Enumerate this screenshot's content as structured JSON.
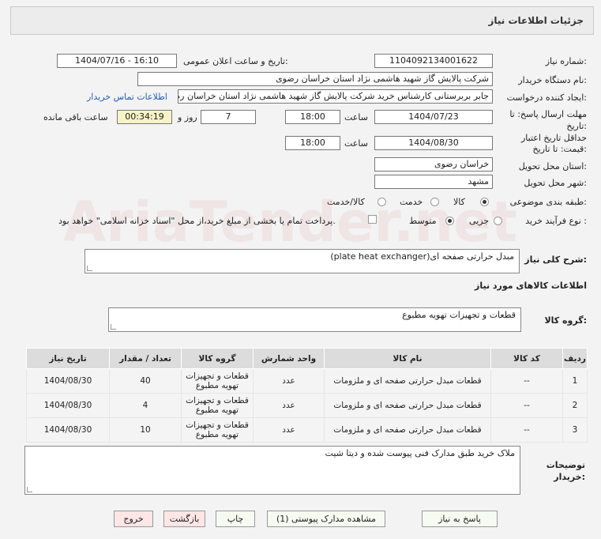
{
  "header": {
    "title": "جزئیات اطلاعات نیاز"
  },
  "fields": {
    "need_number_label": "شماره نیاز:",
    "need_number": "1104092134001622",
    "announce_label": "تاریخ و ساعت اعلان عمومی:",
    "announce_value": "1404/07/16 - 16:10",
    "buyer_org_label": "نام دستگاه خریدار:",
    "buyer_org": "شرکت پالایش گاز شهید هاشمی نژاد   استان خراسان رضوی",
    "creator_label": "ایجاد کننده درخواست:",
    "creator": "جابر بربرستانی کارشناس خرید شرکت پالایش گاز شهید هاشمی نژاد   استان خراسان رضوی",
    "contact_link": "اطلاعات تماس خریدار",
    "deadline_label_1": "مهلت ارسال پاسخ: تا",
    "deadline_label_2": "تاریخ:",
    "deadline_date": "1404/07/23",
    "time_label": "ساعت",
    "deadline_time": "18:00",
    "days_value": "7",
    "days_label": "روز و",
    "remaining_value": "00:34:19",
    "remaining_label": "ساعت باقی مانده",
    "validity_label_1": "حداقل تاریخ اعتبار",
    "validity_label_2": "قیمت: تا تاریخ:",
    "validity_date": "1404/08/30",
    "validity_time": "18:00",
    "province_label": "استان محل تحویل:",
    "province": "خراسان رضوی",
    "city_label": "شهر محل تحویل:",
    "city": "مشهد",
    "category_label": "طبقه بندی موضوعی:",
    "cat_goods": "کالا",
    "cat_service": "خدمت",
    "cat_both": "کالا/خدمت",
    "process_label": "نوع فرآیند خرید :",
    "proc_small": "جزیی",
    "proc_medium": "متوسط",
    "payment_note": "پرداخت تمام یا بخشی از مبلغ خرید،از محل \"اسناد خزانه اسلامی\" خواهد بود."
  },
  "description": {
    "label": "شرح کلی نیاز:",
    "value": "مبدل حرارتی صفحه ای(plate heat exchanger)"
  },
  "goods_info": {
    "title": "اطلاعات کالاهای مورد نیاز",
    "group_label": "گروه کالا:",
    "group_value": "قطعات و تجهیزات تهویه مطبوع"
  },
  "table": {
    "headers": [
      "ردیف",
      "کد کالا",
      "نام کالا",
      "واحد شمارش",
      "گروه کالا",
      "تعداد / مقدار",
      "تاریخ نیاز"
    ],
    "rows": [
      [
        "1",
        "--",
        "قطعات مبدل حرارتی صفحه ای و ملزومات",
        "عدد",
        "قطعات و تجهیزات تهویه مطبوع",
        "40",
        "1404/08/30"
      ],
      [
        "2",
        "--",
        "قطعات مبدل حرارتی صفحه ای و ملزومات",
        "عدد",
        "قطعات و تجهیزات تهویه مطبوع",
        "4",
        "1404/08/30"
      ],
      [
        "3",
        "--",
        "قطعات مبدل حرارتی صفحه ای و ملزومات",
        "عدد",
        "قطعات و تجهیزات تهویه مطبوع",
        "10",
        "1404/08/30"
      ]
    ]
  },
  "buyer_notes": {
    "label_1": "توضیحات",
    "label_2": "خریدار:",
    "value": "ملاک خرید طبق مدارک فنی پیوست شده و دیتا شیت"
  },
  "buttons": {
    "reply": "پاسخ به نیاز",
    "attachments": "مشاهده مدارک پیوستی (1)",
    "print": "چاپ",
    "back": "بازگشت",
    "exit": "خروج"
  },
  "watermark": "AriaTender.net"
}
